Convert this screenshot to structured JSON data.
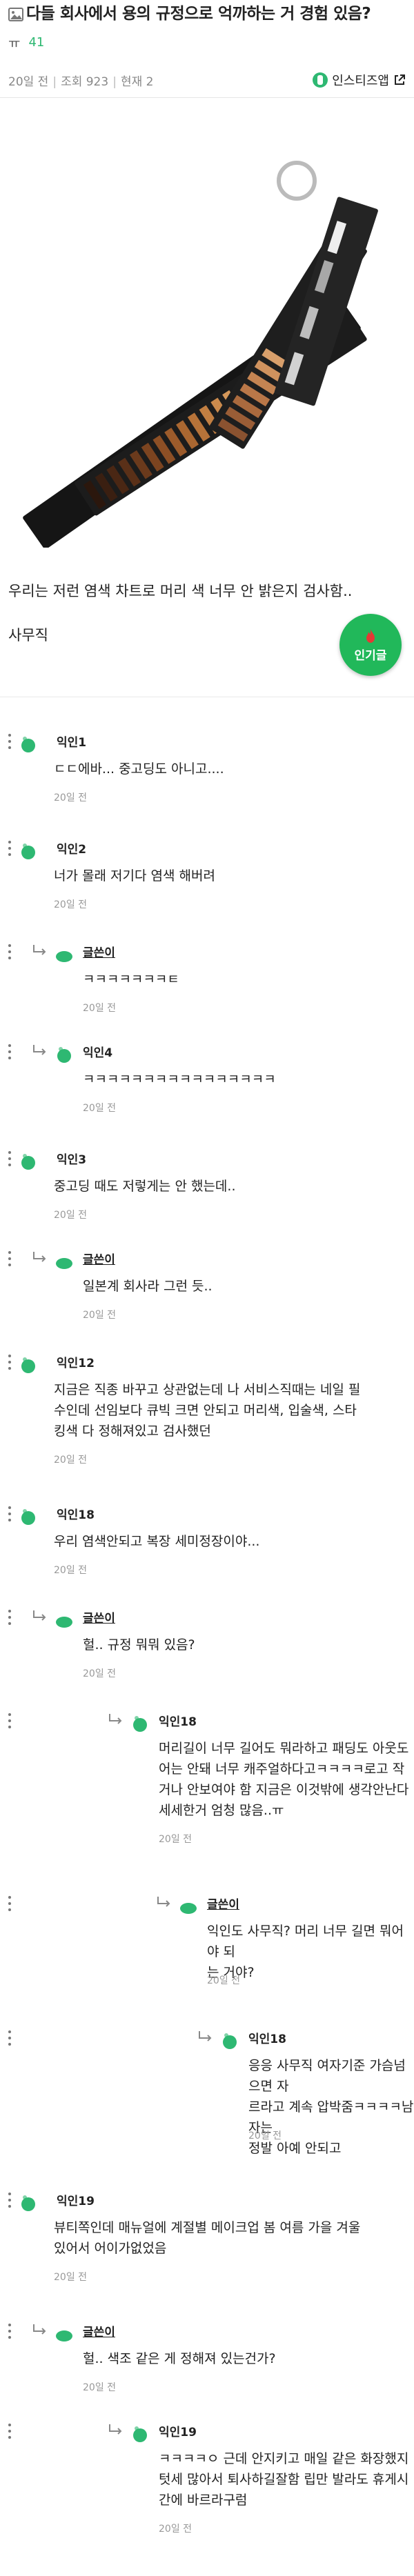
{
  "post": {
    "title": "다들 회사에서 용의 규정으로 억까하는 거 경험 있음?",
    "author": "ㅠ",
    "author_count": "41",
    "time": "20일 전",
    "views": "조회 923",
    "status": "현재 2",
    "instiz_label": "인스티즈앱",
    "body_line1": "우리는 저런 염색 차트로 머리 색 너무 안 밝은지 검사함..",
    "body_line2": "사무직",
    "popular_label": "인기글"
  },
  "colors": {
    "accent": "#2eb872",
    "popular": "#21b85a",
    "avatar": "#2eb872"
  },
  "comments": [
    {
      "nick": "익인1",
      "text": [
        "ㄷㄷ에바... 중고딩도 아니고...."
      ],
      "time": "20일 전"
    },
    {
      "nick": "익인2",
      "text": [
        "너가 몰래 저기다 염색 해버려"
      ],
      "time": "20일 전"
    },
    {
      "nick": "글쓴이",
      "text": [
        "ㅋㅋㅋㅋㅋㅋㅋㅌ"
      ],
      "time": "20일 전"
    },
    {
      "nick": "익인4",
      "text": [
        "ㅋㅋㅋㅋㅋㅋㅋㅋㅋㅋㅋㅋㅋㅋㅋㅋ"
      ],
      "time": "20일 전"
    },
    {
      "nick": "익인3",
      "text": [
        "중고딩 때도 저렇게는 안 했는데.."
      ],
      "time": "20일 전"
    },
    {
      "nick": "글쓴이",
      "text": [
        "일본계 회사라 그런 듯.."
      ],
      "time": "20일 전"
    },
    {
      "nick": "익인12",
      "text": [
        "지금은 직종 바꾸고 상관없는데 나 서비스직때는 네일 필",
        "수인데 선임보다 큐빅 크면 안되고 머리색, 입술색, 스타",
        "킹색 다 정해져있고 검사했던"
      ],
      "time": "20일 전"
    },
    {
      "nick": "익인18",
      "text": [
        "우리 염색안되고 복장 세미정장이야..."
      ],
      "time": "20일 전"
    },
    {
      "nick": "글쓴이",
      "text": [
        "헐.. 규정 뭐뭐 있음?"
      ],
      "time": "20일 전"
    },
    {
      "nick": "익인18",
      "text": [
        "머리길이 너무 길어도 뭐라하고 패딩도 아웃도",
        "어는 안돼 너무 캐주얼하다고ㅋㅋㅋㅋ로고 작",
        "거나 안보여야 함 지금은 이것밖에 생각안난다",
        "세세한거 엄청 많음..ㅠ"
      ],
      "time": "20일 전"
    },
    {
      "nick": "글쓴이",
      "text": [
        "익인도 사무직? 머리 너무 길면 뭐어야 되",
        "는 거야?"
      ],
      "time": "20일 전"
    },
    {
      "nick": "익인18",
      "text": [
        "응응 사무직 여자기준 가슴넘으면 자",
        "르라고 계속 압박줌ㅋㅋㅋㅋ남자는",
        "정발 아예 안되고"
      ],
      "time": "20일 전"
    },
    {
      "nick": "익인19",
      "text": [
        "뷰티쪽인데 매뉴얼에 계절별 메이크업 봄 여름 가을 겨울",
        "있어서 어이가없었음"
      ],
      "time": "20일 전"
    },
    {
      "nick": "글쓴이",
      "text": [
        "헐.. 색조 같은 게 정해져 있는건가?"
      ],
      "time": "20일 전"
    },
    {
      "nick": "익인19",
      "text": [
        "ㅋㅋㅋㅋㅇ 근데 안지키고 매일 같은 화장했지",
        "텃세 많아서 퇴사하길잘함 립만 발라도 휴게시",
        "간에 바르라구럼"
      ],
      "time": "20일 전"
    }
  ]
}
